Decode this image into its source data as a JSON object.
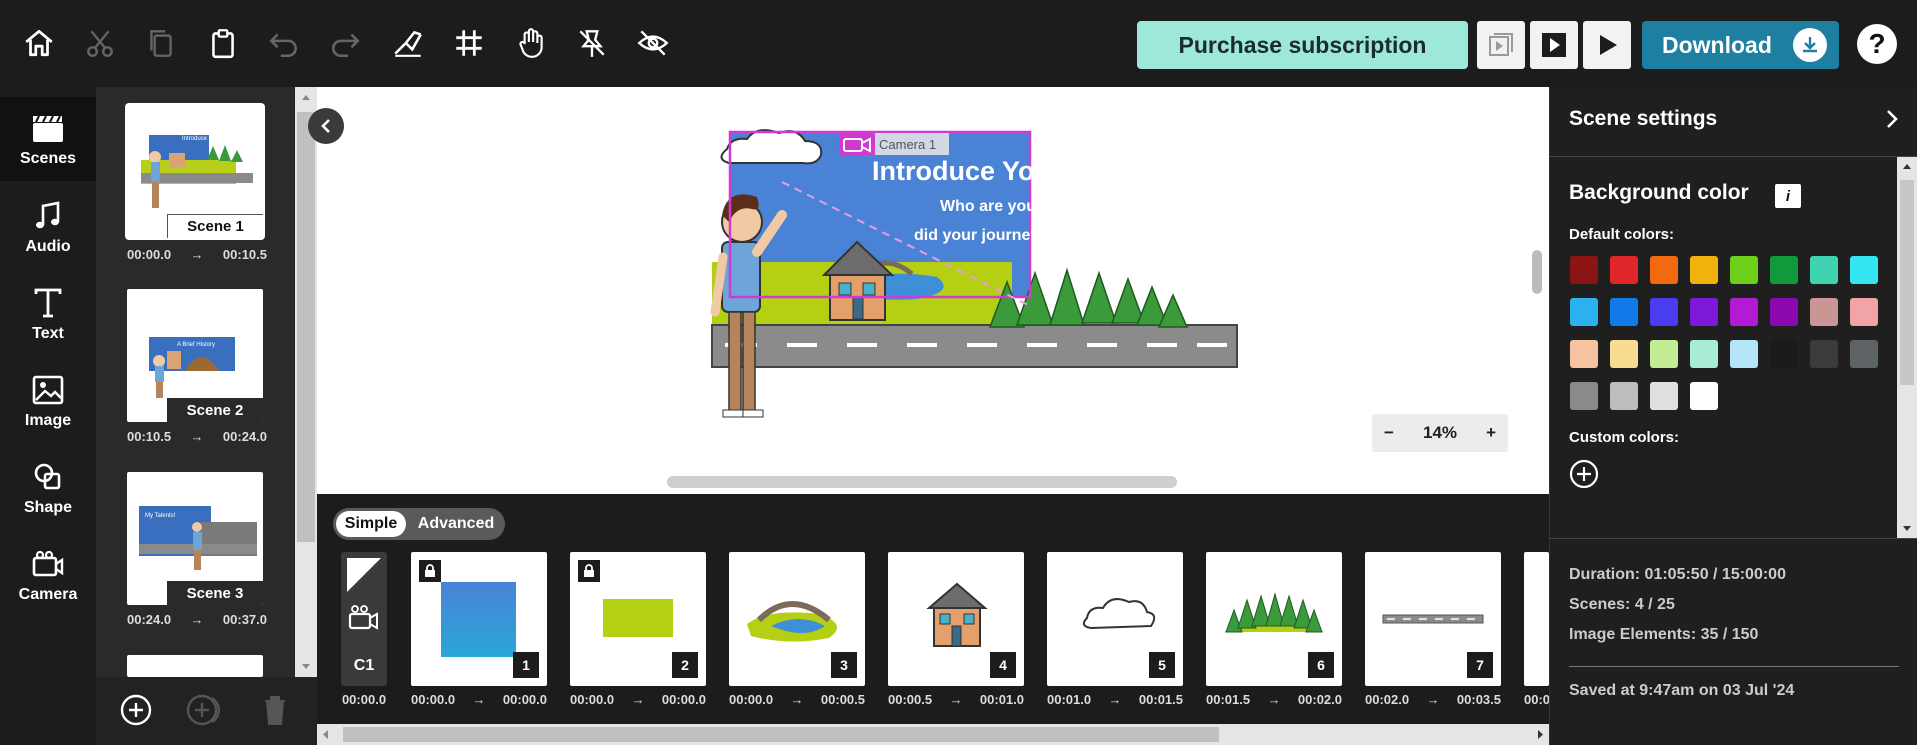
{
  "toolbar": {
    "icons": [
      "home-icon",
      "scissors-icon",
      "copy-icon",
      "clipboard-icon",
      "undo-icon",
      "redo-icon",
      "draw-hand-icon",
      "grid-icon",
      "hand-icon",
      "unpin-icon",
      "eye-off-icon"
    ],
    "purchase_label": "Purchase subscription",
    "download_label": "Download",
    "help_label": "?"
  },
  "leftnav": {
    "items": [
      {
        "label": "Scenes",
        "icon": "clapperboard-icon"
      },
      {
        "label": "Audio",
        "icon": "music-icon"
      },
      {
        "label": "Text",
        "icon": "text-icon"
      },
      {
        "label": "Image",
        "icon": "image-icon"
      },
      {
        "label": "Shape",
        "icon": "shape-icon"
      },
      {
        "label": "Camera",
        "icon": "camera-icon"
      }
    ]
  },
  "scenes": [
    {
      "label": "Scene 1",
      "start": "00:00.0",
      "end": "00:10.5"
    },
    {
      "label": "Scene 2",
      "start": "00:10.5",
      "end": "00:24.0"
    },
    {
      "label": "Scene 3",
      "start": "00:24.0",
      "end": "00:37.0"
    }
  ],
  "scene_thumbs": {
    "s1_title": "Introduce Yourself!",
    "s2_title": "A Brief History",
    "s3_title": "My Talents!"
  },
  "canvas": {
    "camera_label": "Camera 1",
    "headline": "Introduce Yourself!",
    "subline1": "Who are you and how",
    "subline2": "did your journey begin?",
    "zoom": "14%",
    "zoom_minus": "−",
    "zoom_plus": "+"
  },
  "timeline": {
    "mode_simple": "Simple",
    "mode_advanced": "Advanced",
    "camera_chip": "C1",
    "camera_time": "00:00.0",
    "cards": [
      {
        "num": "1",
        "start": "00:00.0",
        "end": "00:00.0",
        "locked": true
      },
      {
        "num": "2",
        "start": "00:00.0",
        "end": "00:00.0",
        "locked": true
      },
      {
        "num": "3",
        "start": "00:00.0",
        "end": "00:00.5",
        "locked": false
      },
      {
        "num": "4",
        "start": "00:00.5",
        "end": "00:01.0",
        "locked": false
      },
      {
        "num": "5",
        "start": "00:01.0",
        "end": "00:01.5",
        "locked": false
      },
      {
        "num": "6",
        "start": "00:01.5",
        "end": "00:02.0",
        "locked": false
      },
      {
        "num": "7",
        "start": "00:02.0",
        "end": "00:03.5",
        "locked": false
      }
    ],
    "partial_time": "00:0"
  },
  "right_panel": {
    "title": "Scene settings",
    "bg_title": "Background color",
    "info_label": "i",
    "default_colors_label": "Default colors:",
    "custom_colors_label": "Custom colors:",
    "default_colors": [
      "#8b1414",
      "#e0262b",
      "#f26a10",
      "#f2b20c",
      "#6fcf1a",
      "#119a3a",
      "#3fd3b0",
      "#33e5ef",
      "#2ab2f0",
      "#1479e8",
      "#4a3cf0",
      "#7a19d6",
      "#b21ad6",
      "#8a0ab0",
      "#c99595",
      "#f2a3a8",
      "#f7c2a0",
      "#f7dc92",
      "#c3ec95",
      "#a8ecd8",
      "#b5e6f7",
      "#1a1a1a",
      "#3b3b3b",
      "#5e6366",
      "#8a8a8a",
      "#bdbdbd",
      "#e0e0e0",
      "#ffffff"
    ],
    "duration": "Duration: 01:05:50 / 15:00:00",
    "scenes_count": "Scenes: 4 / 25",
    "image_elements": "Image Elements: 35 / 150",
    "saved": "Saved at 9:47am on 03 Jul '24"
  }
}
